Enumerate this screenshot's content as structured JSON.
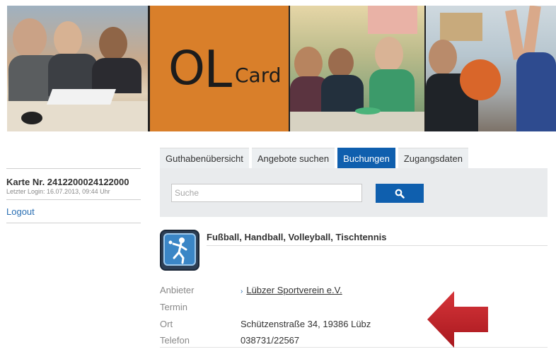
{
  "banner": {
    "logo_big_letters": "OL",
    "logo_o": "O",
    "logo_l": "L",
    "logo_small_word": "Card"
  },
  "sidebar": {
    "card_number": "Karte Nr. 2412200024122000",
    "last_login": "Letzter Login: 16.07.2013, 09:44 Uhr",
    "logout_label": "Logout"
  },
  "tabs": [
    {
      "label": "Guthabenübersicht",
      "active": false
    },
    {
      "label": "Angebote suchen",
      "active": false
    },
    {
      "label": "Buchungen",
      "active": true
    },
    {
      "label": "Zugangsdaten",
      "active": false
    }
  ],
  "search": {
    "placeholder": "Suche",
    "value": "",
    "button_icon": "search-icon"
  },
  "result": {
    "icon": "tennis-player-icon",
    "title": "Fußball, Handball, Volleyball, Tischtennis",
    "details": {
      "provider_label": "Anbieter",
      "provider_value": "Lübzer Sportverein e.V.",
      "date_label": "Termin",
      "date_value": "",
      "place_label": "Ort",
      "place_value": "Schützenstraße 34, 19386 Lübz",
      "phone_label": "Telefon",
      "phone_value": "038731/22567"
    }
  },
  "colors": {
    "accent_blue": "#0f5fae",
    "link_blue": "#2a6fb3",
    "arrow_red": "#c0262b",
    "banner_orange": "#d97f2a"
  }
}
